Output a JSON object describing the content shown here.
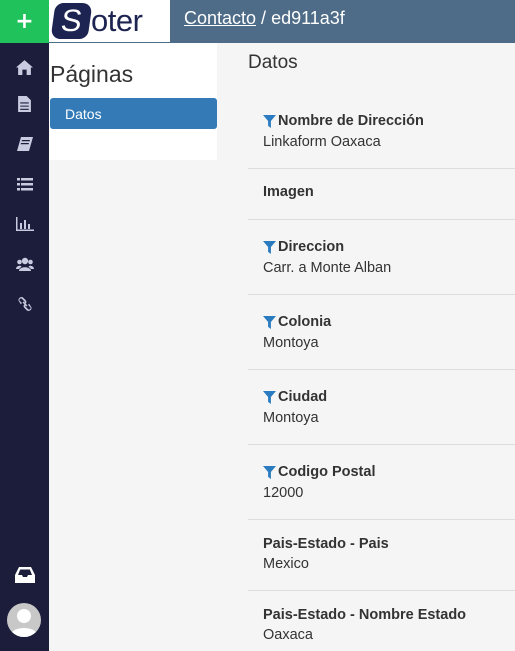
{
  "app": {
    "logo_first_letter": "S",
    "logo_rest": "oter"
  },
  "header": {
    "breadcrumb_link": "Contacto",
    "breadcrumb_separator": " / ",
    "breadcrumb_current": "ed911a3f"
  },
  "rail": {
    "add_label": "+",
    "icons": [
      "home-icon",
      "document-icon",
      "book-icon",
      "list-icon",
      "bar-chart-icon",
      "users-icon",
      "link-icon",
      "inbox-icon",
      "user-avatar"
    ]
  },
  "pages": {
    "title": "Páginas",
    "items": [
      {
        "label": "Datos"
      }
    ]
  },
  "main": {
    "title": "Datos",
    "fields": [
      {
        "label": "Nombre de Dirección",
        "value": "Linkaform Oaxaca",
        "filter": true
      },
      {
        "label": "Imagen",
        "value": "",
        "filter": false
      },
      {
        "label": "Direccion",
        "value": "Carr. a Monte Alban",
        "filter": true
      },
      {
        "label": "Colonia",
        "value": "Montoya",
        "filter": true
      },
      {
        "label": "Ciudad",
        "value": "Montoya",
        "filter": true
      },
      {
        "label": "Codigo Postal",
        "value": "12000",
        "filter": true
      },
      {
        "label": "Pais-Estado - Pais",
        "value": "Mexico",
        "filter": false
      },
      {
        "label": "Pais-Estado - Nombre Estado",
        "value": "Oaxaca",
        "filter": false
      }
    ]
  },
  "colors": {
    "rail_bg": "#1b1d3b",
    "add_button": "#20c25c",
    "header_bg": "#4e6c87",
    "active_page": "#337ab7",
    "filter_icon": "#2b7bc0"
  }
}
